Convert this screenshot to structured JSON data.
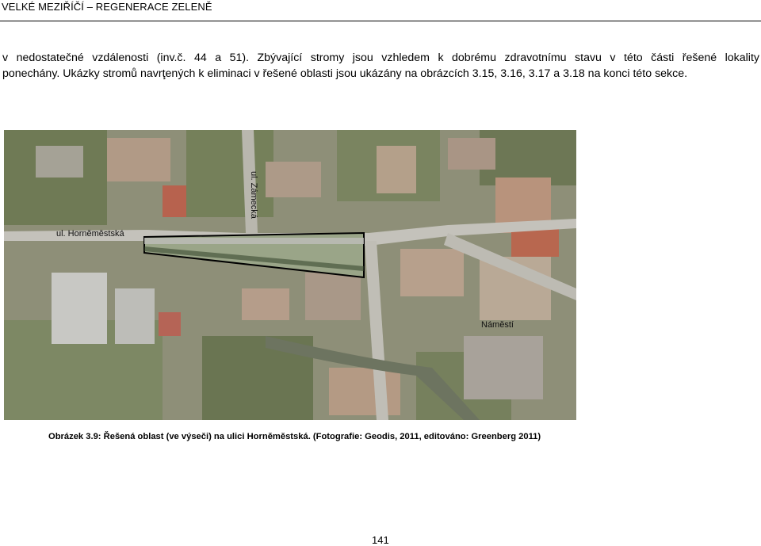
{
  "header": {
    "title": "VELKÉ MEZIŘÍČÍ – REGENERACE ZELENĚ"
  },
  "body": {
    "line1": "v nedostatečné vzdálenosti (inv.č. 44 a 51). Zbývající stromy jsou vzhledem k dobrému zdravotnímu stavu v této části řešené lokality",
    "line2": "ponechány. Ukázky stromů navrţených k eliminaci v řešené oblasti jsou ukázány na obrázcích 3.15, 3.16, 3.17 a 3.18 na konci této sekce."
  },
  "figure": {
    "labels": {
      "street_zamecka": "ul. Zámecká",
      "street_hornomestska": "ul. Horněměstská",
      "square": "Náměstí"
    },
    "caption": "Obrázek 3.9: Řešená oblast (ve výseči) na ulici Horněměstská. (Fotografie: Geodis, 2011, editováno: Greenberg 2011)"
  },
  "page": {
    "number": "141"
  }
}
